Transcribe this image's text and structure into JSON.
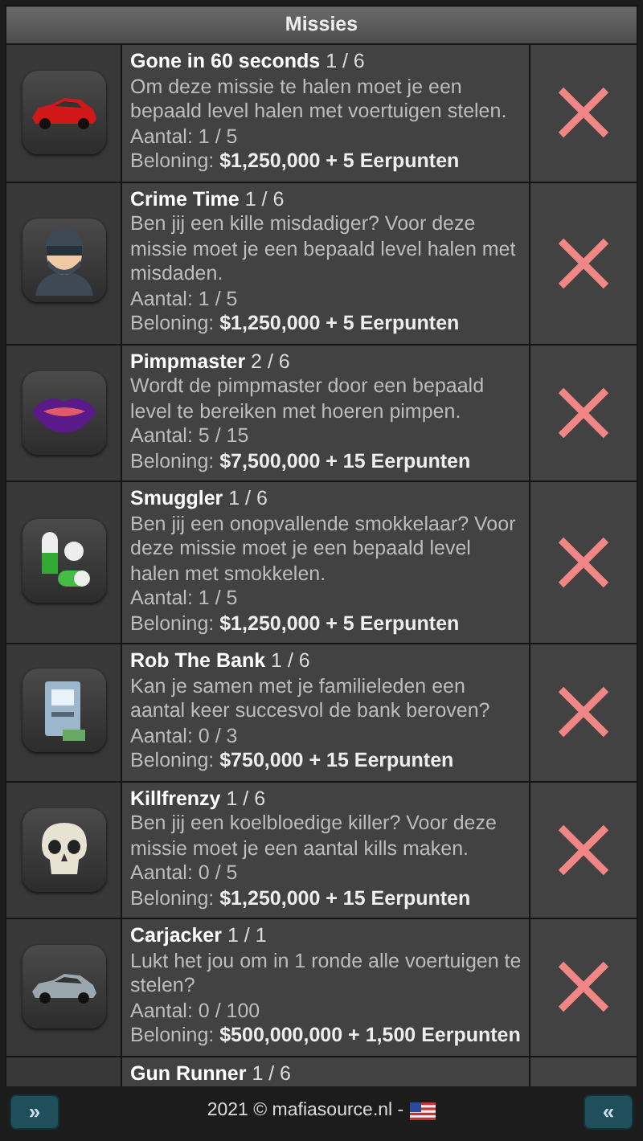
{
  "header": {
    "title": "Missies"
  },
  "missions": [
    {
      "kind": "red-car",
      "title": "**Gone in 60 seconds** 1 / 6",
      "description": "Om deze missie te halen moet je een bepaald level halen met voertuigen stelen.",
      "count": "Aantal: 1 / 5",
      "reward": "Beloning: **$1,250,000 + 5 Eerpunten**",
      "completed": false
    },
    {
      "kind": "masked-man",
      "title": "**Crime Time** 1 / 6",
      "description": "Ben jij een kille misdadiger? Voor deze missie moet je een bepaald level halen met misdaden.",
      "count": "Aantal: 1 / 5",
      "reward": "Beloning: **$1,250,000 + 5 Eerpunten**",
      "completed": false
    },
    {
      "kind": "lips",
      "title": "**Pimpmaster** 2 / 6",
      "description": "Wordt de pimpmaster door een bepaald level te bereiken met hoeren pimpen.",
      "count": "Aantal: 5 / 15",
      "reward": "Beloning: **$7,500,000 + 15 Eerpunten**",
      "completed": false
    },
    {
      "kind": "pills",
      "title": "**Smuggler** 1 / 6",
      "description": "Ben jij een onopvallende smokkelaar? Voor deze missie moet je een bepaald level halen met smokkelen.",
      "count": "Aantal: 1 / 5",
      "reward": "Beloning: **$1,250,000 + 5 Eerpunten**",
      "completed": false
    },
    {
      "kind": "atm",
      "title": "**Rob The Bank** 1 / 6",
      "description": "Kan je samen met je familieleden een aantal keer succesvol de bank beroven?",
      "count": "Aantal: 0 / 3",
      "reward": "Beloning: **$750,000 + 15 Eerpunten**",
      "completed": false
    },
    {
      "kind": "skull",
      "title": "**Killfrenzy** 1 / 6",
      "description": "Ben jij een koelbloedige killer? Voor deze missie moet je een aantal kills maken.",
      "count": "Aantal: 0 / 5",
      "reward": "Beloning: **$1,250,000 + 15 Eerpunten**",
      "completed": false
    },
    {
      "kind": "silver-car",
      "title": "**Carjacker** 1 / 1",
      "description": "Lukt het jou om in 1 ronde alle voertuigen te stelen?",
      "count": "Aantal: 0 / 100",
      "reward": "Beloning: **$500,000,000 + 1,500 Eerpunten**",
      "completed": false
    },
    {
      "title": "**Gun Runner** 1 / 6"
    }
  ],
  "footer": {
    "left_button": "»",
    "text": "2021 © mafiasource.nl -",
    "right_button": "«"
  }
}
